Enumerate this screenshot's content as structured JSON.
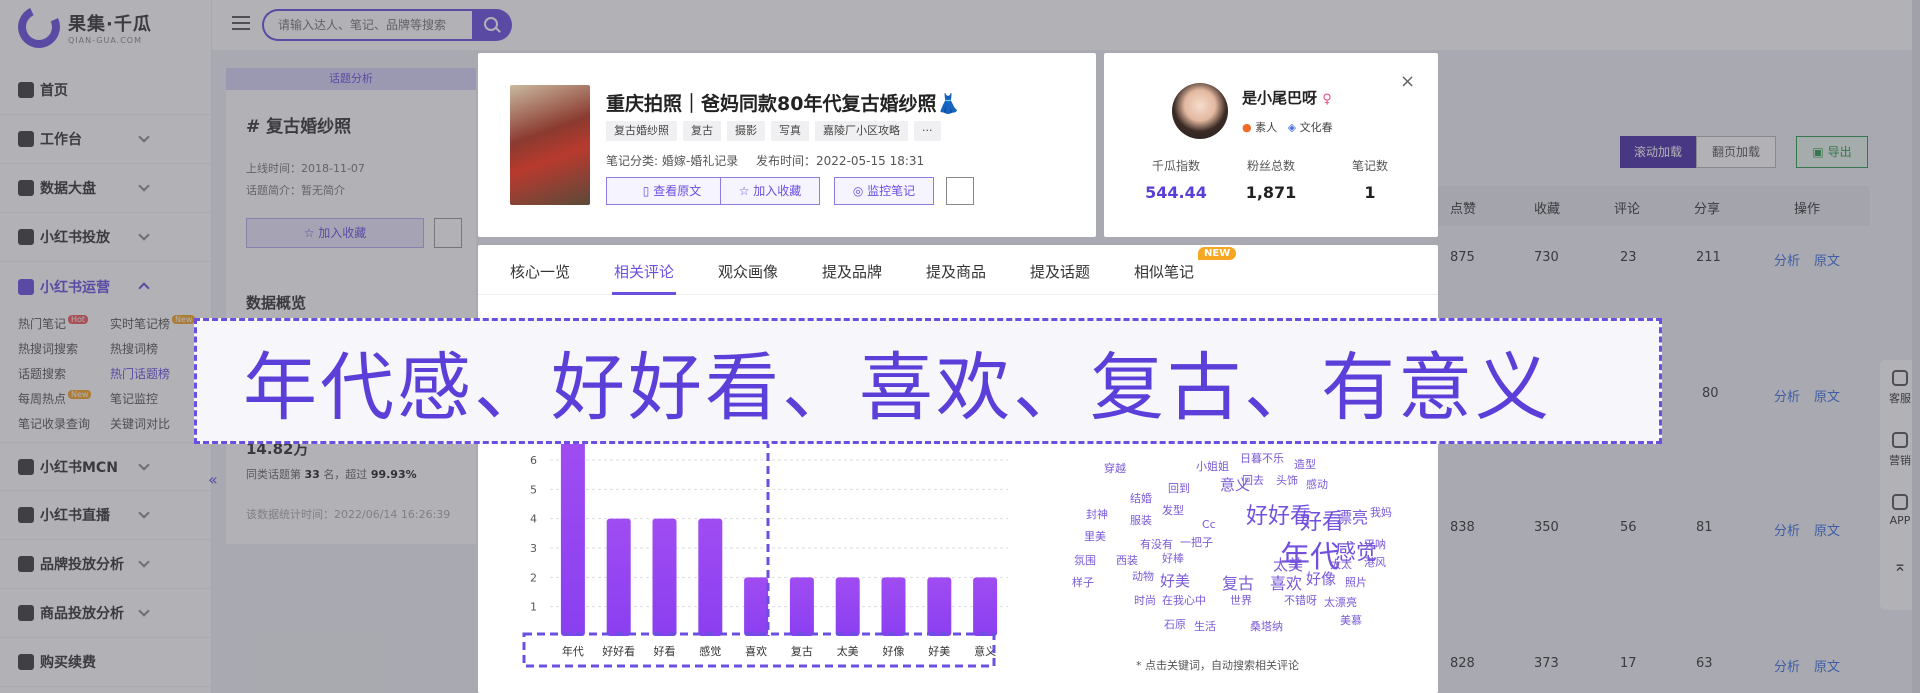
{
  "brand": {
    "name_cn": "果集·千瓜",
    "name_en": "QIAN-GUA.COM"
  },
  "search": {
    "placeholder": "请输入达人、笔记、品牌等搜索"
  },
  "sidebar": {
    "items": [
      {
        "label": "首页"
      },
      {
        "label": "工作台"
      },
      {
        "label": "数据大盘"
      },
      {
        "label": "小红书投放"
      },
      {
        "label": "小红书运营"
      }
    ],
    "sub": [
      {
        "label": "热门笔记",
        "badge": "Hot"
      },
      {
        "label": "实时笔记榜",
        "badge": "New"
      },
      {
        "label": "热搜词搜索"
      },
      {
        "label": "热搜词榜"
      },
      {
        "label": "话题搜索"
      },
      {
        "label": "热门话题榜"
      },
      {
        "label": "每周热点",
        "badge": "New"
      },
      {
        "label": "笔记监控"
      },
      {
        "label": "笔记收录查询"
      },
      {
        "label": "关键词对比"
      }
    ],
    "items2": [
      {
        "label": "小红书MCN"
      },
      {
        "label": "小红书直播"
      },
      {
        "label": "品牌投放分析"
      },
      {
        "label": "商品投放分析"
      },
      {
        "label": "购买续费"
      }
    ]
  },
  "bg": {
    "header": "话题分析",
    "title": "复古婚纱照",
    "online": "上线时间：2018-11-07",
    "intro": "话题简介：暂无简介",
    "fav": "加入收藏",
    "overview": "数据概览",
    "big": "14.82万",
    "same_prefix": "同类话题第",
    "same_rank": "33",
    "same_mid": "名，超过",
    "same_pct": "99.93%",
    "stat_time": "该数据统计时间：2022/06/14 16:26:39",
    "btn_scroll": "滚动加载",
    "btn_page": "翻页加载",
    "btn_export": "导出",
    "columns": [
      "点赞",
      "收藏",
      "评论",
      "分享",
      "操作"
    ],
    "rows": [
      {
        "likes": "875",
        "fav": "730",
        "comments": "23",
        "shares": "211"
      },
      {
        "likes": "",
        "fav": "",
        "comments": "",
        "shares": "80"
      },
      {
        "likes": "838",
        "fav": "350",
        "comments": "56",
        "shares": "81"
      },
      {
        "likes": "828",
        "fav": "373",
        "comments": "17",
        "shares": "63"
      }
    ],
    "link_analyze": "分析",
    "link_original": "原文"
  },
  "tools": [
    "客服",
    "营销",
    "APP"
  ],
  "note": {
    "title": "重庆拍照｜爸妈同款80年代复古婚纱照👗",
    "tags": [
      "复古婚纱照",
      "复古",
      "摄影",
      "写真",
      "嘉陵厂小区攻略",
      "···"
    ],
    "category": "笔记分类: 婚嫁-婚礼记录",
    "published": "发布时间：2022-05-15 18:31",
    "btn_view": "查看原文",
    "btn_fav": "加入收藏",
    "btn_monitor": "监控笔记"
  },
  "author": {
    "name": "是小尾巴呀",
    "gender": "♀",
    "tag1": "素人",
    "tag2": "文化春",
    "close": "×",
    "stats": [
      {
        "label": "千瓜指数",
        "value": "544.44"
      },
      {
        "label": "粉丝总数",
        "value": "1,871"
      },
      {
        "label": "笔记数",
        "value": "1"
      }
    ]
  },
  "tabs": [
    "核心一览",
    "相关评论",
    "观众画像",
    "提及品牌",
    "提及商品",
    "提及话题",
    "相似笔记"
  ],
  "tab_new": "NEW",
  "banner": "年代感、好好看、喜欢、复古、有意义",
  "chart_data": {
    "type": "bar",
    "categories": [
      "年代",
      "好好看",
      "好看",
      "感觉",
      "喜欢",
      "复古",
      "太美",
      "好像",
      "好美",
      "意义"
    ],
    "values": [
      7,
      4,
      4,
      4,
      2,
      2,
      2,
      2,
      2,
      2
    ],
    "ylim": [
      0,
      6
    ],
    "yticks": [
      "1",
      "2",
      "3",
      "4",
      "5",
      "6"
    ],
    "color": "#8a3ff0"
  },
  "cloud": {
    "words": [
      "穿越",
      "小姐姐",
      "日暮不乐",
      "造型",
      "回到",
      "意义",
      "回去",
      "头饰",
      "感动",
      "结婚",
      "封神",
      "服装",
      "发型",
      "好好看",
      "好看",
      "漂亮",
      "我妈",
      "里美",
      "有没有",
      "一把子",
      "Cc",
      "年代",
      "感觉",
      "天呐",
      "氛围",
      "西装",
      "好棒",
      "太美",
      "太太",
      "港风",
      "样子",
      "动物",
      "好美",
      "复古",
      "喜欢",
      "好像",
      "照片",
      "时尚",
      "在我心中",
      "世界",
      "不错呀",
      "太漂亮",
      "美慕",
      "石原",
      "生活",
      "桑塔纳"
    ],
    "note": "* 点击关键词，自动搜索相关评论"
  }
}
